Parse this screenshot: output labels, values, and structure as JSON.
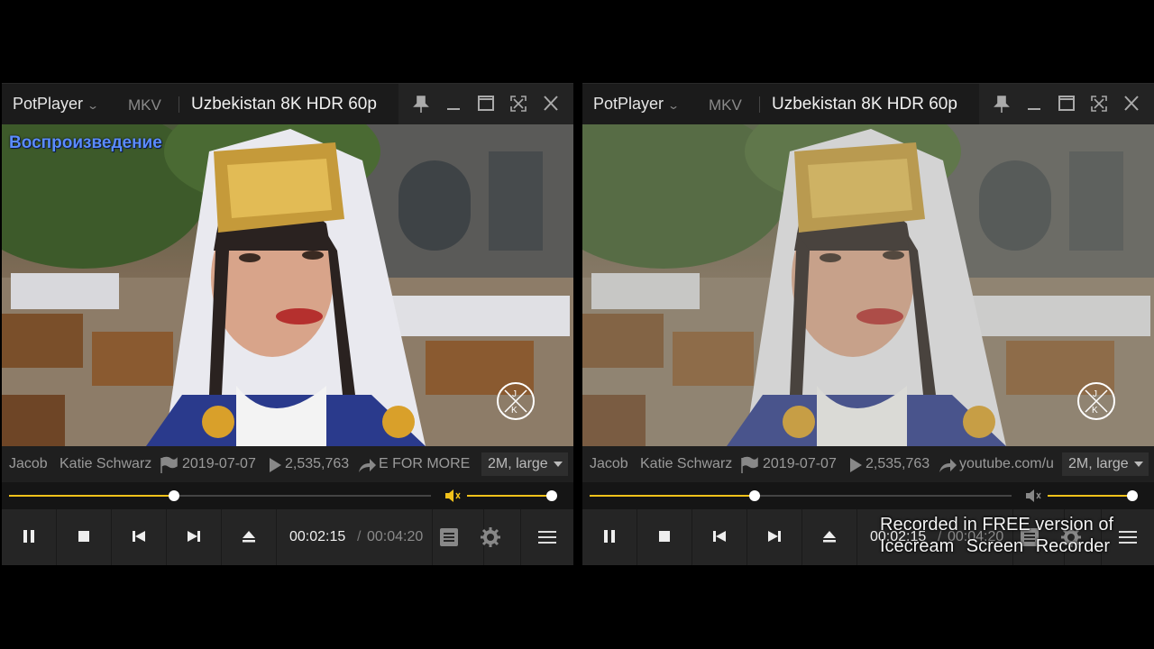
{
  "players": [
    {
      "app": "PotPlayer",
      "format": "MKV",
      "title": "Uzbekistan 8K HDR 60p",
      "osd_text": "Воспроизведение",
      "info": {
        "author": "Jacob",
        "presenter": "Katie Schwarz",
        "date": "2019-07-07",
        "views": "2,535,763",
        "link": "E FOR MORE",
        "quality": "2M, large"
      },
      "progress": 0.39,
      "volume": 1.0,
      "time_current": "00:02:15",
      "time_separator": "/",
      "time_total": "00:04:20"
    },
    {
      "app": "PotPlayer",
      "format": "MKV",
      "title": "Uzbekistan 8K HDR 60p",
      "osd_text": "",
      "info": {
        "author": "Jacob",
        "presenter": "Katie Schwarz",
        "date": "2019-07-07",
        "views": "2,535,763",
        "link": "youtube.com/u",
        "quality": "2M, large"
      },
      "progress": 0.39,
      "volume": 1.0,
      "time_current": "00:02:15",
      "time_separator": "/",
      "time_total": "00:04:20"
    }
  ],
  "icons": {
    "titlebar": [
      "pin-icon",
      "minimize-icon",
      "maximize-icon",
      "fullscreen-icon",
      "close-icon"
    ],
    "controls": [
      "pause-icon",
      "stop-icon",
      "previous-icon",
      "next-icon",
      "eject-icon",
      "playlist-icon",
      "settings-gear-icon",
      "menu-icon"
    ]
  },
  "colors": {
    "accent": "#f2c21b",
    "osd": "#5b8cff",
    "background": "#000000"
  },
  "recorder_watermark": {
    "line1": "Recorded in FREE version of",
    "line2": "Icecream Screen Recorder"
  }
}
